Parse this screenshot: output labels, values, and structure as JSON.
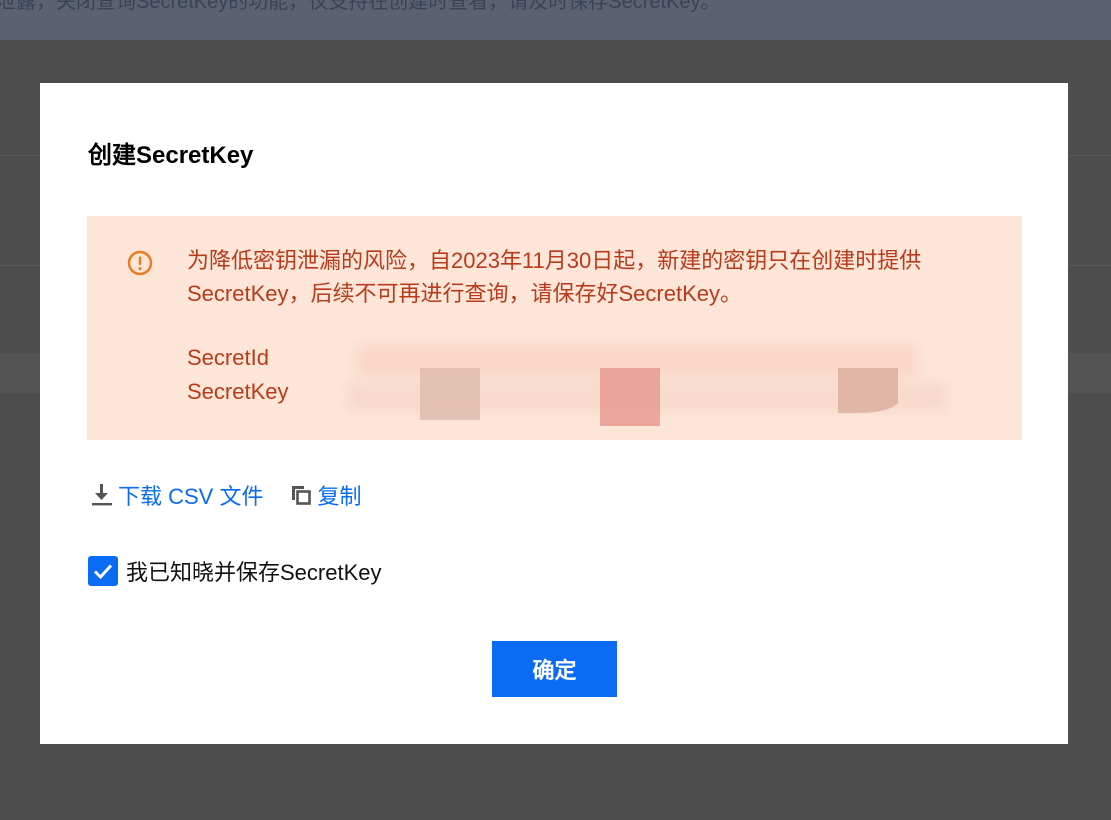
{
  "background": {
    "banner_text": "泄露，关闭查询SecretKey的功能，仅支持在创建时查看，请及时保存SecretKey。"
  },
  "modal": {
    "title": "创建SecretKey",
    "notice": {
      "icon": "exclamation-circle-icon",
      "message": "为降低密钥泄漏的风险，自2023年11月30日起，新建的密钥只在创建时提供SecretKey，后续不可再进行查询，请保存好SecretKey。",
      "secret_id_label": "SecretId",
      "secret_key_label": "SecretKey"
    },
    "actions": {
      "download_label": "下载 CSV 文件",
      "download_icon": "download-icon",
      "copy_label": "复制",
      "copy_icon": "copy-icon"
    },
    "acknowledge": {
      "label": "我已知晓并保存SecretKey",
      "checked": true
    },
    "confirm_label": "确定"
  },
  "colors": {
    "accent": "#0a6cf5",
    "warning_bg": "#fde6d8",
    "warning_text": "#b83b1c",
    "warning_icon": "#ee7a1c",
    "overlay": "#4d4d4d"
  }
}
